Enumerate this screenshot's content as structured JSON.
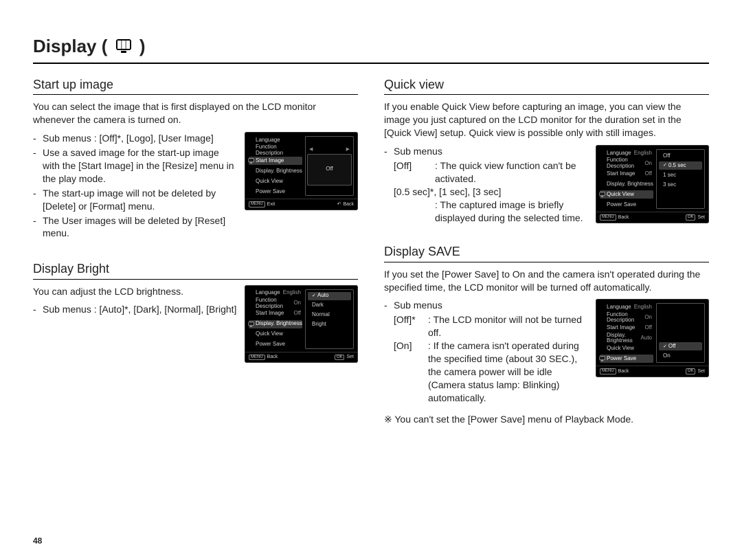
{
  "page_number": "48",
  "page_title_prefix": "Display (",
  "page_title_suffix": " )",
  "sections": {
    "startup": {
      "title": "Start up image",
      "intro": "You can select the image that is first displayed on the LCD monitor whenever the camera is turned on.",
      "bullets": [
        "Sub menus : [Off]*, [Logo], [User Image]",
        "Use a saved image for the start-up image with the [Start Image] in the [Resize] menu in the play mode.",
        "The start-up image will not be deleted by [Delete] or [Format] menu.",
        "The User images will be deleted by [Reset] menu."
      ]
    },
    "bright": {
      "title": "Display Bright",
      "intro": "You can adjust the LCD brightness.",
      "bullet_label": "Sub menus :",
      "bullet_values": "[Auto]*, [Dark], [Normal], [Bright]"
    },
    "quick": {
      "title": "Quick view",
      "intro": "If you enable Quick View before capturing an image, you can view the image you just captured on the LCD monitor for the duration set in the [Quick View] setup. Quick view is possible only with still images.",
      "sub_label": "Sub menus",
      "defs": {
        "off_k": "[Off]",
        "off_v": "The quick view function can't be activated.",
        "times_k": "[0.5 sec]*, [1 sec], [3 sec]",
        "times_v": "The captured image is briefly displayed during the selected time."
      }
    },
    "save": {
      "title": "Display SAVE",
      "intro": "If you set the [Power Save] to On and the camera isn't operated during the specified time, the LCD monitor will be turned off automatically.",
      "sub_label": "Sub menus",
      "defs": {
        "off_k": "[Off]*",
        "off_v": "The LCD monitor will not be turned off.",
        "on_k": "[On]",
        "on_v": "If the camera isn't operated during the specified time (about 30 SEC.), the camera power will be idle (Camera status lamp: Blinking) automatically."
      },
      "note": "You can't set the [Power Save] menu of Playback Mode."
    }
  },
  "cam_menu": {
    "items": {
      "language": "Language",
      "funcdesc": "Function Description",
      "startimg": "Start Image",
      "dispbright": "Display. Brightness",
      "quickview": "Quick View",
      "powersave": "Power Save"
    },
    "vals": {
      "english": "English",
      "on": "On",
      "off": "Off",
      "auto": "Auto",
      "sec05": "0.5 sec"
    },
    "opts": {
      "startimg_sel": "Off",
      "bright_list": [
        "Auto",
        "Dark",
        "Normal",
        "Bright"
      ],
      "quick_list": [
        "Off",
        "0.5 sec",
        "1 sec",
        "3 sec"
      ],
      "save_list": [
        "Off",
        "On"
      ]
    },
    "foot": {
      "menu": "MENU",
      "ok": "OK",
      "exit": "Exit",
      "back": "Back",
      "set": "Set"
    }
  }
}
